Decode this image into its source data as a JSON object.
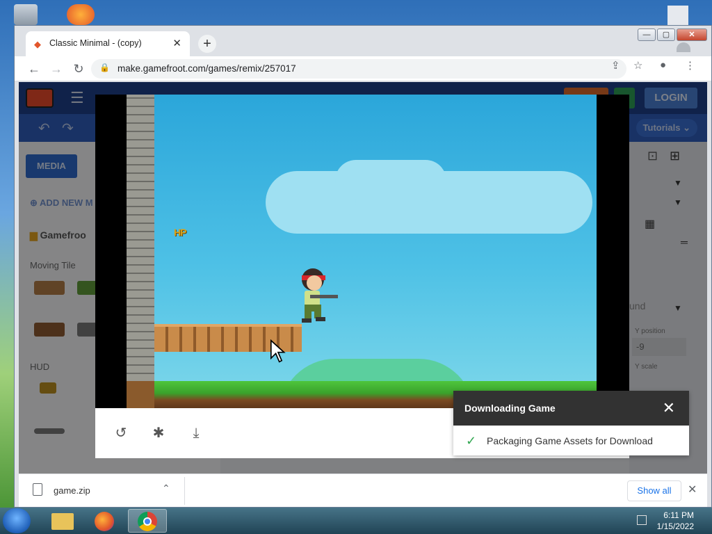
{
  "browser": {
    "tab_title": "Classic Minimal - (copy)",
    "url": "make.gamefroot.com/games/remix/257017",
    "window_min": "—",
    "window_max": "▢",
    "window_close": "✕"
  },
  "app": {
    "login_label": "LOGIN",
    "tutorials_label": "Tutorials",
    "media_label": "MEDIA",
    "add_new_label": "ADD NEW M",
    "folder_label": "Gamefroo",
    "moving_tile_label": "Moving Tile",
    "hud_label": "HUD",
    "bound_text": "und",
    "y_position_label": "Y position",
    "y_position_value": "-9",
    "y_scale_label": "Y scale"
  },
  "game": {
    "hp_label": "HP"
  },
  "toast": {
    "title": "Downloading Game",
    "message": "Packaging Game Assets for Download"
  },
  "download_bar": {
    "file_name": "game.zip",
    "show_all_label": "Show all"
  },
  "taskbar": {
    "time": "6:11 PM",
    "date": "1/15/2022"
  },
  "colors": {
    "app_header": "#1e3f87",
    "toast_header": "#323232",
    "success_check": "#34a853",
    "link_blue": "#1a73e8"
  }
}
